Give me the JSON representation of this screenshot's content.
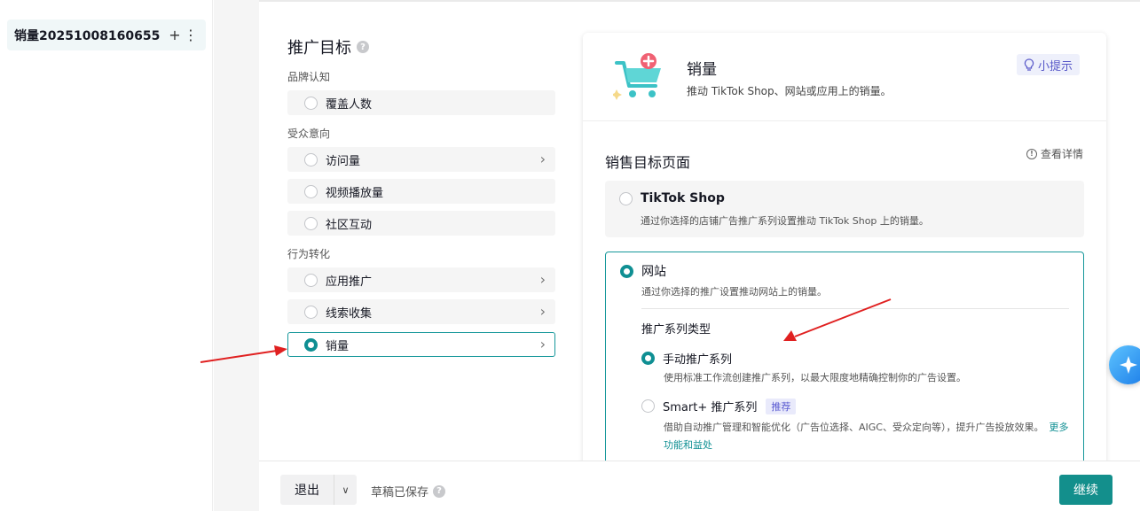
{
  "sidebar": {
    "campaign_name": "销量20251008160655",
    "add_icon": "plus-icon",
    "more_icon": "more-vertical-icon"
  },
  "objective": {
    "title": "推广目标",
    "help_icon": "question-icon",
    "groups": [
      {
        "label": "品牌认知"
      },
      {
        "label": "受众意向"
      },
      {
        "label": "行为转化"
      }
    ],
    "items": [
      {
        "label": "覆盖人数",
        "selected": false,
        "chevron": false
      },
      {
        "label": "访问量",
        "selected": false,
        "chevron": true
      },
      {
        "label": "视频播放量",
        "selected": false,
        "chevron": false
      },
      {
        "label": "社区互动",
        "selected": false,
        "chevron": false
      },
      {
        "label": "应用推广",
        "selected": false,
        "chevron": true
      },
      {
        "label": "线索收集",
        "selected": false,
        "chevron": true
      },
      {
        "label": "销量",
        "selected": true,
        "chevron": true
      }
    ]
  },
  "panel": {
    "title": "销量",
    "description": "推动 TikTok Shop、网站或应用上的销量。",
    "tip_label": "小提示",
    "tip_icon": "lightbulb-icon",
    "section_title": "销售目标页面",
    "details_label": "查看详情",
    "options": [
      {
        "name": "TikTok Shop",
        "desc": "通过你选择的店铺广告推广系列设置推动 TikTok Shop 上的销量。",
        "selected": false
      },
      {
        "name": "网站",
        "desc": "通过你选择的推广设置推动网站上的销量。",
        "selected": true
      }
    ],
    "campaign_type": {
      "title": "推广系列类型",
      "manual": {
        "name": "手动推广系列",
        "desc": "使用标准工作流创建推广系列，以最大限度地精确控制你的广告设置。",
        "selected": true
      },
      "smart": {
        "name": "Smart+ 推广系列",
        "badge": "推荐",
        "desc": "借助自动推广管理和智能优化（广告位选择、AIGC、受众定向等），提升广告投放效果。",
        "more_link": "更多功能和益处",
        "selected": false
      }
    }
  },
  "footer": {
    "exit_label": "退出",
    "draft_status": "草稿已保存",
    "continue_label": "继续"
  },
  "colors": {
    "accent": "#0f8f93",
    "annotation_arrow": "#e02020"
  }
}
